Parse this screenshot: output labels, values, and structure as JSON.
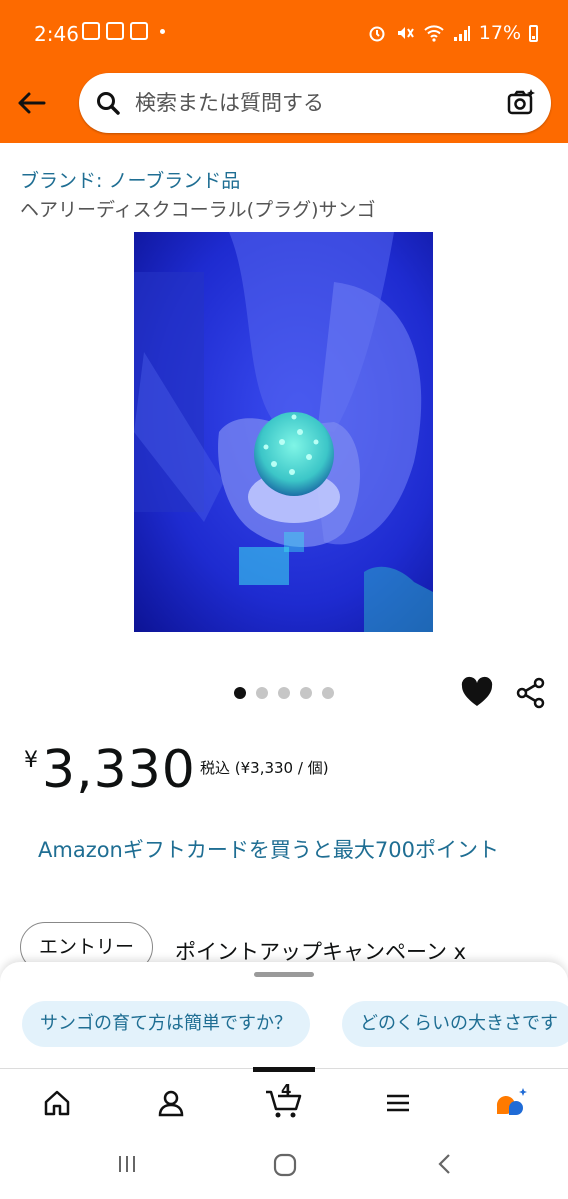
{
  "status_bar": {
    "time": "2:46",
    "battery": "17%"
  },
  "search": {
    "placeholder": "検索または質問する"
  },
  "product": {
    "brand": "ブランド: ノーブランド品",
    "title": "ヘアリーディスクコーラル(プラグ)サンゴ",
    "image_count": 5,
    "image_index": 1,
    "currency_symbol": "¥",
    "price": "3,330",
    "tax_note": "税込 (¥3,330 / 個)"
  },
  "promo": {
    "gift_text": "Amazonギフトカードを買うと最大700ポイント",
    "entry_label": "エントリー",
    "campaign_text": "ポイントアップキャンペーン x"
  },
  "sheet": {
    "chips": [
      "サンゴの育て方は簡単ですか？",
      "どのくらいの大きさです"
    ]
  },
  "bottom_nav": {
    "cart_count": "4",
    "items": [
      "home-icon",
      "account-icon",
      "cart-icon",
      "menu-icon",
      "rufus-icon"
    ]
  },
  "colors": {
    "header": "#fd6a00",
    "link": "#1f6e93",
    "chip_bg": "#e3f2fb"
  }
}
